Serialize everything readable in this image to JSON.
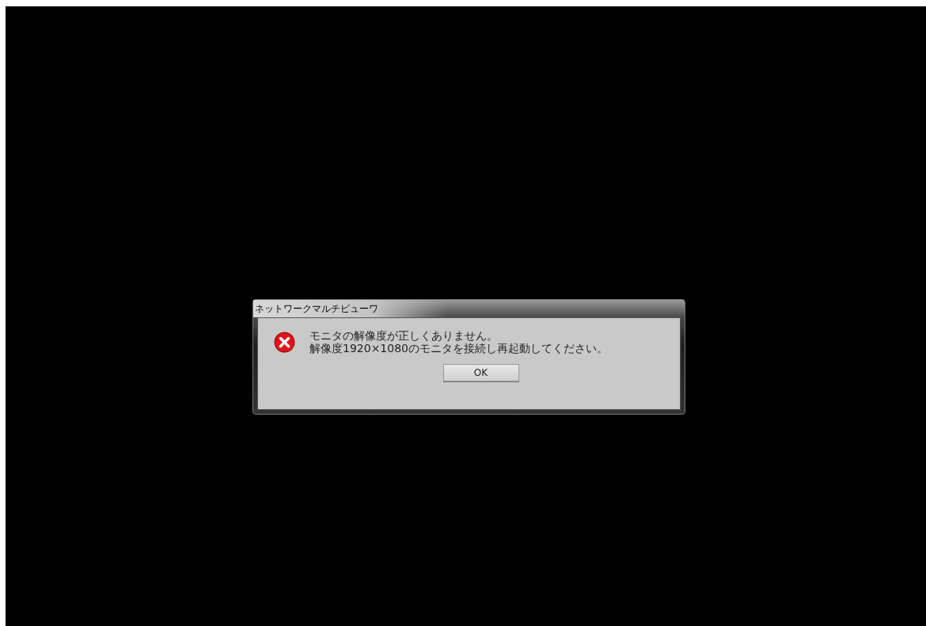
{
  "dialog": {
    "title": "ネットワークマルチビューワ",
    "message_lines": [
      "モニタの解像度が正しくありません。",
      "解像度1920×1080のモニタを接続し再起動してください。"
    ],
    "buttons": [
      "OK"
    ]
  }
}
